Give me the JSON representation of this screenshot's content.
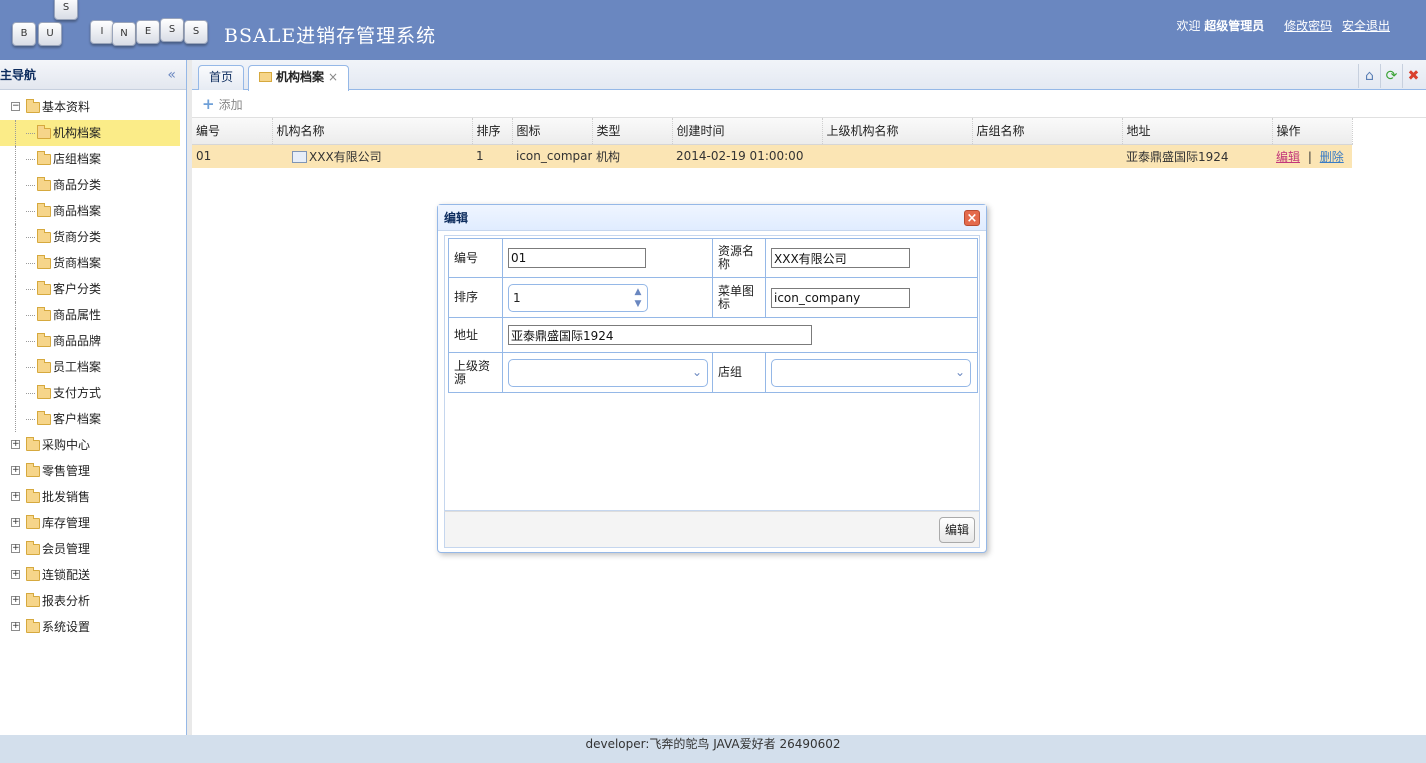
{
  "header": {
    "logo_letters": [
      "B",
      "U",
      "S",
      "I",
      "N",
      "E",
      "S",
      "S"
    ],
    "system_title": "BSALE进销存管理系统",
    "welcome": "欢迎",
    "user_name": "超级管理员",
    "change_password": "修改密码",
    "logout": "安全退出"
  },
  "nav": {
    "title": "主导航",
    "collapse_glyph": "«",
    "groups": [
      {
        "label": "基本资料",
        "expanded": true,
        "children": [
          "机构档案",
          "店组档案",
          "商品分类",
          "商品档案",
          "货商分类",
          "货商档案",
          "客户分类",
          "商品属性",
          "商品品牌",
          "员工档案",
          "支付方式",
          "客户档案"
        ]
      },
      {
        "label": "采购中心"
      },
      {
        "label": "零售管理"
      },
      {
        "label": "批发销售"
      },
      {
        "label": "库存管理"
      },
      {
        "label": "会员管理"
      },
      {
        "label": "连锁配送"
      },
      {
        "label": "报表分析"
      },
      {
        "label": "系统设置"
      }
    ],
    "selected": "机构档案"
  },
  "tabs": [
    {
      "label": "首页",
      "active": false
    },
    {
      "label": "机构档案",
      "active": true,
      "close": "×"
    }
  ],
  "tab_tools": [
    "home-icon",
    "refresh-icon",
    "close-all-icon"
  ],
  "toolbar": {
    "add_label": "添加"
  },
  "grid": {
    "columns": [
      "编号",
      "机构名称",
      "排序",
      "图标",
      "类型",
      "创建时间",
      "上级机构名称",
      "店组名称",
      "地址",
      "操作"
    ],
    "rows": [
      {
        "id": "01",
        "name": "XXX有限公司",
        "sort": "1",
        "icon": "icon_company",
        "type": "机构",
        "created": "2014-02-19 01:00:00",
        "parent": "",
        "group": "",
        "address": "亚泰鼎盛国际1924",
        "edit": "编辑",
        "sep": "|",
        "delete": "删除"
      }
    ]
  },
  "dialog": {
    "title": "编辑",
    "fields": {
      "id_label": "编号",
      "id_value": "01",
      "name_label": "资源名称",
      "name_value": "XXX有限公司",
      "sort_label": "排序",
      "sort_value": "1",
      "icon_label": "菜单图标",
      "icon_value": "icon_company",
      "address_label": "地址",
      "address_value": "亚泰鼎盛国际1924",
      "parent_label": "上级资源",
      "parent_value": "",
      "group_label": "店组",
      "group_value": ""
    },
    "submit": "编辑"
  },
  "footer": {
    "text": "developer:飞奔的鸵鸟 JAVA爱好者 26490602"
  },
  "colors": {
    "header_bg": "#6a87c0",
    "selected_row": "#fbe5b4",
    "tree_selected": "#fbec88",
    "border": "#95b8e7"
  }
}
